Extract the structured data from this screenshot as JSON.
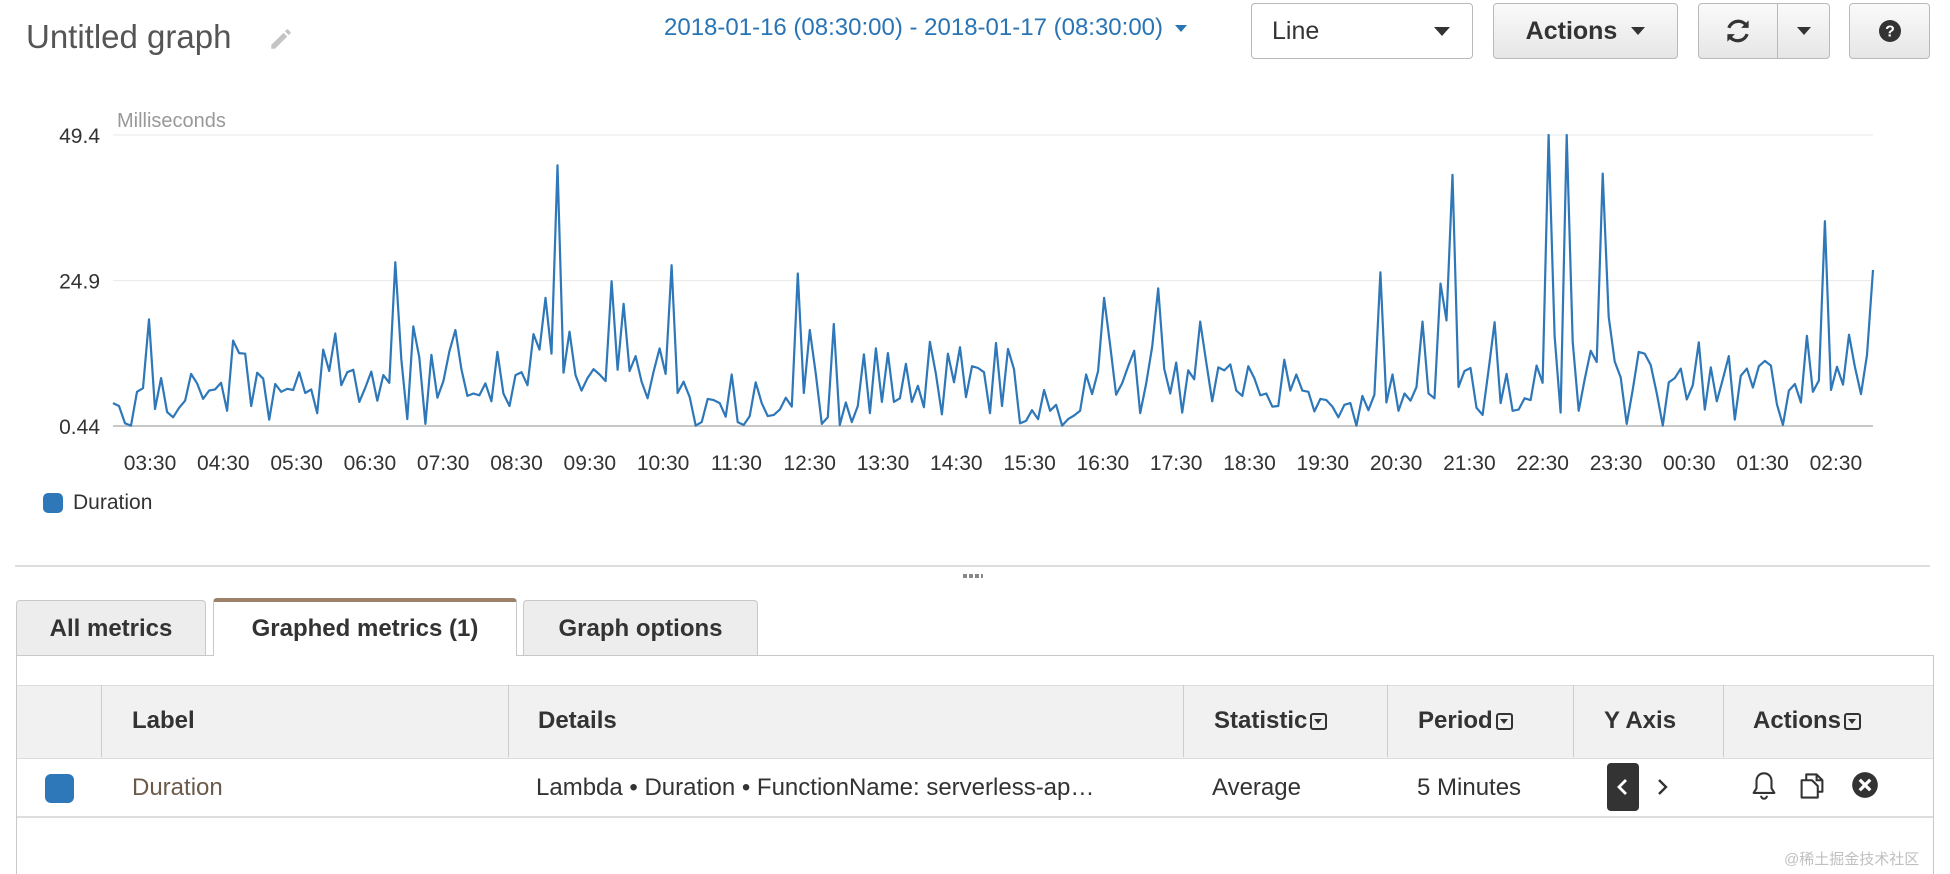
{
  "header": {
    "title": "Untitled graph",
    "date_range": "2018-01-16 (08:30:00) - 2018-01-17 (08:30:00)",
    "chart_type_select": "Line",
    "actions_label": "Actions",
    "help_label": "?"
  },
  "chart_data": {
    "type": "line",
    "ylabel": "Milliseconds",
    "yticks": [
      "49.4",
      "24.9",
      "0.44"
    ],
    "ylim": [
      0.44,
      49.4
    ],
    "xticks": [
      "03:30",
      "04:30",
      "05:30",
      "06:30",
      "07:30",
      "08:30",
      "09:30",
      "10:30",
      "11:30",
      "12:30",
      "13:30",
      "14:30",
      "15:30",
      "16:30",
      "17:30",
      "18:30",
      "19:30",
      "20:30",
      "21:30",
      "22:30",
      "23:30",
      "00:30",
      "01:30",
      "02:30"
    ],
    "x_start": "2018-01-16 08:30:00",
    "x_step_minutes": 5,
    "legend_position": "bottom-left",
    "grid": true,
    "series": [
      {
        "name": "Duration",
        "color": "#2e77b8",
        "values": [
          4.3,
          3.8,
          0.9,
          0.5,
          6.2,
          6.8,
          18.4,
          3.3,
          8.5,
          2.8,
          1.9,
          3.5,
          4.7,
          9.2,
          7.6,
          5.0,
          6.4,
          6.6,
          7.7,
          3.0,
          14.8,
          12.7,
          12.6,
          3.8,
          9.4,
          8.4,
          1.5,
          7.5,
          6.2,
          6.7,
          6.5,
          9.5,
          6.0,
          6.6,
          2.6,
          13.3,
          9.7,
          16.0,
          7.3,
          9.5,
          9.9,
          4.5,
          6.9,
          9.6,
          4.7,
          9.0,
          7.7,
          28.0,
          11.7,
          1.6,
          17.2,
          12.0,
          0.8,
          12.4,
          5.2,
          8.0,
          13.0,
          16.6,
          10.0,
          5.5,
          5.9,
          5.6,
          7.6,
          4.6,
          12.9,
          5.9,
          3.8,
          9.0,
          9.5,
          7.3,
          15.9,
          13.3,
          22.0,
          12.6,
          44.3,
          9.4,
          16.3,
          9.0,
          6.4,
          8.5,
          10.0,
          9.1,
          8.0,
          24.8,
          9.9,
          21.0,
          9.7,
          12.2,
          7.9,
          5.1,
          9.6,
          13.5,
          9.2,
          27.5,
          6.0,
          7.9,
          5.3,
          0.5,
          1.1,
          5.0,
          4.8,
          4.3,
          2.0,
          9.1,
          1.1,
          0.6,
          2.1,
          7.8,
          4.3,
          2.1,
          2.3,
          3.2,
          5.2,
          3.7,
          26.1,
          6.0,
          16.6,
          9.2,
          0.8,
          1.9,
          17.6,
          0.6,
          4.4,
          1.1,
          3.8,
          12.5,
          2.6,
          13.5,
          4.5,
          12.7,
          4.5,
          5.1,
          10.9,
          4.5,
          7.2,
          3.6,
          14.6,
          9.2,
          2.4,
          12.6,
          7.8,
          13.7,
          5.3,
          10.5,
          10.2,
          9.5,
          2.6,
          14.4,
          3.8,
          13.4,
          10.0,
          0.9,
          1.3,
          3.1,
          1.6,
          6.5,
          3.0,
          4.0,
          0.5,
          1.6,
          2.2,
          3.0,
          9.1,
          5.8,
          9.7,
          22.0,
          14.1,
          5.7,
          7.6,
          10.5,
          13.1,
          2.6,
          7.6,
          13.8,
          23.6,
          10.1,
          5.9,
          11.1,
          2.7,
          9.8,
          8.3,
          18.0,
          11.2,
          4.6,
          10.3,
          9.8,
          10.8,
          6.4,
          5.5,
          10.5,
          8.5,
          5.6,
          5.9,
          3.7,
          3.8,
          11.6,
          6.4,
          9.1,
          6.4,
          6.2,
          2.9,
          5.0,
          4.8,
          3.7,
          1.9,
          4.0,
          4.3,
          0.5,
          5.5,
          3.1,
          5.7,
          26.3,
          4.4,
          9.1,
          3.0,
          5.9,
          4.7,
          7.0,
          18.0,
          5.9,
          5.1,
          24.4,
          18.2,
          42.7,
          7.0,
          9.7,
          10.2,
          3.5,
          2.3,
          9.9,
          17.9,
          4.3,
          9.2,
          3.0,
          3.2,
          5.1,
          4.8,
          10.6,
          7.7,
          49.4,
          15.6,
          2.7,
          49.4,
          14.6,
          3.0,
          8.3,
          13.1,
          11.2,
          42.9,
          18.8,
          11.3,
          8.6,
          0.8,
          6.5,
          12.9,
          12.6,
          10.7,
          5.9,
          0.5,
          7.8,
          8.5,
          10.1,
          4.9,
          7.3,
          14.5,
          3.2,
          10.3,
          4.6,
          8.3,
          12.2,
          1.5,
          8.9,
          10.1,
          6.9,
          10.5,
          11.4,
          10.6,
          4.1,
          0.6,
          6.4,
          7.5,
          4.4,
          15.6,
          6.2,
          8.1,
          34.9,
          6.5,
          10.4,
          7.4,
          15.8,
          10.3,
          5.8,
          12.4,
          26.7
        ]
      }
    ]
  },
  "legend": {
    "label": "Duration",
    "color": "#2e77b8"
  },
  "tabs": [
    {
      "label": "All metrics",
      "active": false
    },
    {
      "label": "Graphed metrics (1)",
      "active": true
    },
    {
      "label": "Graph options",
      "active": false
    }
  ],
  "table": {
    "headers": [
      "Label",
      "Details",
      "Statistic",
      "Period",
      "Y Axis",
      "Actions"
    ],
    "row": {
      "color": "#2e77b8",
      "label": "Duration",
      "details": "Lambda • Duration • FunctionName: serverless-ap…",
      "statistic": "Average",
      "period": "5 Minutes"
    }
  },
  "watermark": "@稀土掘金技术社区"
}
